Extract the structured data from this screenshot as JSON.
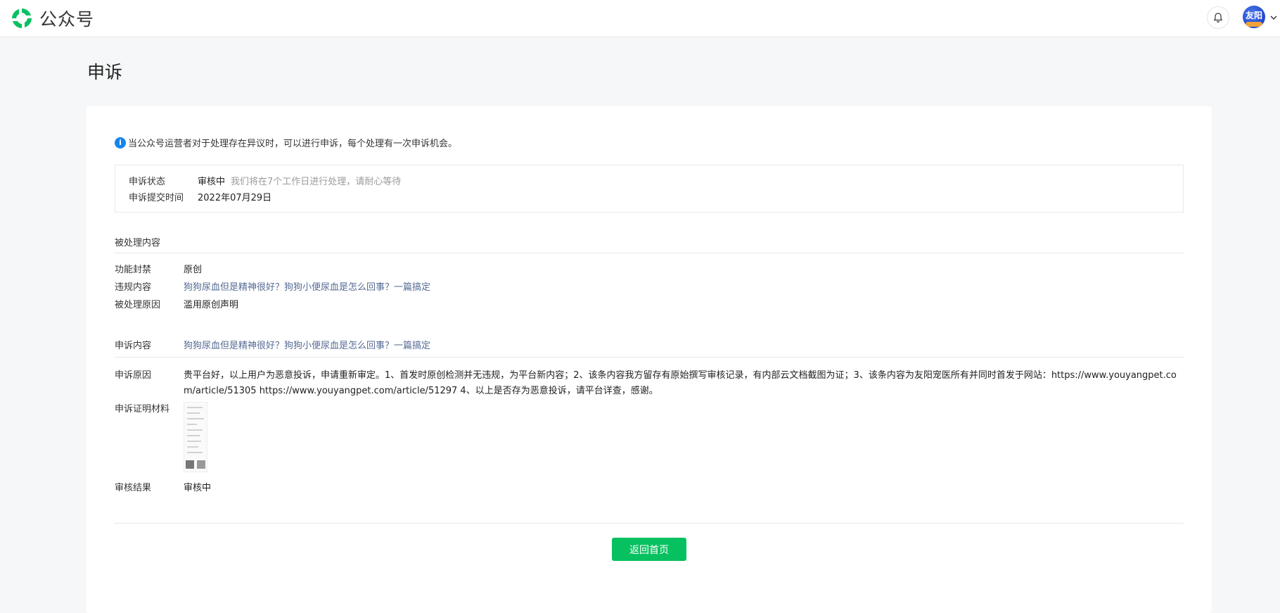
{
  "header": {
    "brand_name": "公众号",
    "avatar_text": "友阳",
    "icons": {
      "logo": "wechat-official-account-logo",
      "notification": "bell-icon",
      "menu": "chevron-down-icon"
    },
    "colors": {
      "brand_green": "#07c160",
      "link": "#576b95",
      "info": "#1485ee"
    }
  },
  "page": {
    "title": "申诉"
  },
  "notice": {
    "icon": "info-icon",
    "text": "当公众号运营者对于处理存在异议时，可以进行申诉，每个处理有一次申诉机会。"
  },
  "status": {
    "state_label": "申诉状态",
    "state_value": "审核中",
    "state_hint": "我们将在7个工作日进行处理，请耐心等待",
    "time_label": "申诉提交时间",
    "time_value": "2022年07月29日"
  },
  "processed": {
    "section_title": "被处理内容",
    "items": [
      {
        "label": "功能封禁",
        "value": "原创",
        "link": false
      },
      {
        "label": "违规内容",
        "value": "狗狗尿血但是精神很好？狗狗小便尿血是怎么回事？一篇搞定",
        "link": true
      },
      {
        "label": "被处理原因",
        "value": "滥用原创声明",
        "link": false
      }
    ]
  },
  "appeal": {
    "content_label": "申诉内容",
    "content_value": "狗狗尿血但是精神很好？狗狗小便尿血是怎么回事？一篇搞定",
    "reason_label": "申诉原因",
    "reason_value": "贵平台好，以上用户为恶意投诉，申请重新审定。1、首发时原创检测并无违规，为平台新内容；2、该条内容我方留存有原始撰写审核记录，有内部云文档截图为证；3、该条内容为友阳宠医所有并同时首发于网站：https://www.youyangpet.com/article/51305 https://www.youyangpet.com/article/51297 4、以上是否存为恶意投诉，请平台详查，感谢。",
    "evidence_label": "申诉证明材料",
    "result_label": "审核结果",
    "result_value": "审核中"
  },
  "actions": {
    "back_label": "返回首页"
  }
}
